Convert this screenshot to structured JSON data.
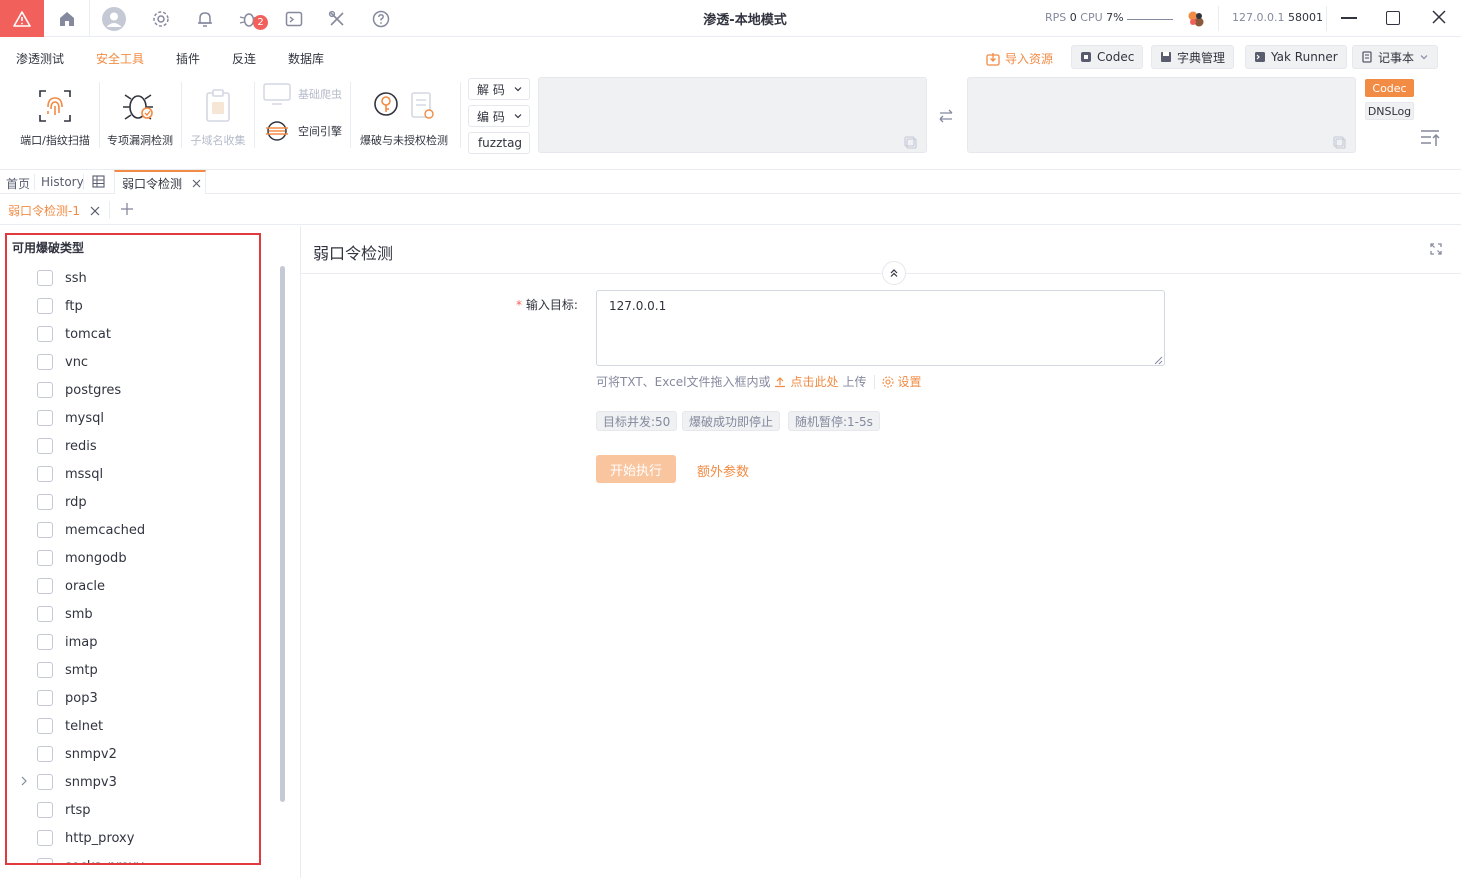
{
  "titlebar": {
    "title": "渗透-本地模式",
    "rps_label": "RPS",
    "rps_value": "0",
    "cpu_label": "CPU",
    "cpu_value": "7%",
    "host": "127.0.0.1",
    "port": "58001",
    "notification_count": "2"
  },
  "menu": {
    "items": [
      "渗透测试",
      "安全工具",
      "插件",
      "反连",
      "数据库"
    ],
    "active_index": 1,
    "import_label": "导入资源",
    "codec_label": "Codec",
    "dict_label": "字典管理",
    "yak_runner_label": "Yak Runner",
    "notepad_label": "记事本"
  },
  "toolbar": {
    "port_scan": "端口/指纹扫描",
    "vuln_detect": "专项漏洞检测",
    "subdomain": "子域名收集",
    "crawler": "基础爬虫",
    "space_engine": "空间引擎",
    "brute": "爆破与未授权检测",
    "decode_label": "解 码",
    "encode_label": "编 码",
    "fuzztag_label": "fuzztag",
    "codec_tab": "Codec",
    "dnslog_tab": "DNSLog"
  },
  "tabs": {
    "home": "首页",
    "history": "History",
    "active_tab": "弱口令检测",
    "sub_tab": "弱口令检测-1"
  },
  "left_panel": {
    "title": "可用爆破类型",
    "types": [
      "ssh",
      "ftp",
      "tomcat",
      "vnc",
      "postgres",
      "mysql",
      "redis",
      "mssql",
      "rdp",
      "memcached",
      "mongodb",
      "oracle",
      "smb",
      "imap",
      "smtp",
      "pop3",
      "telnet",
      "snmpv2",
      "snmpv3",
      "rtsp",
      "http_proxy",
      "socks_proxy"
    ],
    "expandable": "snmpv3"
  },
  "right_panel": {
    "title": "弱口令检测",
    "target_label": "输入目标:",
    "target_value": "127.0.0.1",
    "hint_prefix": "可将TXT、Excel文件拖入框内或",
    "hint_link": "点击此处",
    "hint_suffix": "上传",
    "settings_label": "设置",
    "tags": [
      "目标并发:50",
      "爆破成功即停止",
      "随机暂停:1-5s"
    ],
    "start_button": "开始执行",
    "extra_params": "额外参数"
  },
  "colors": {
    "accent": "#f28b44",
    "warning_red": "#f2605c",
    "highlight_border": "#e0393e"
  }
}
